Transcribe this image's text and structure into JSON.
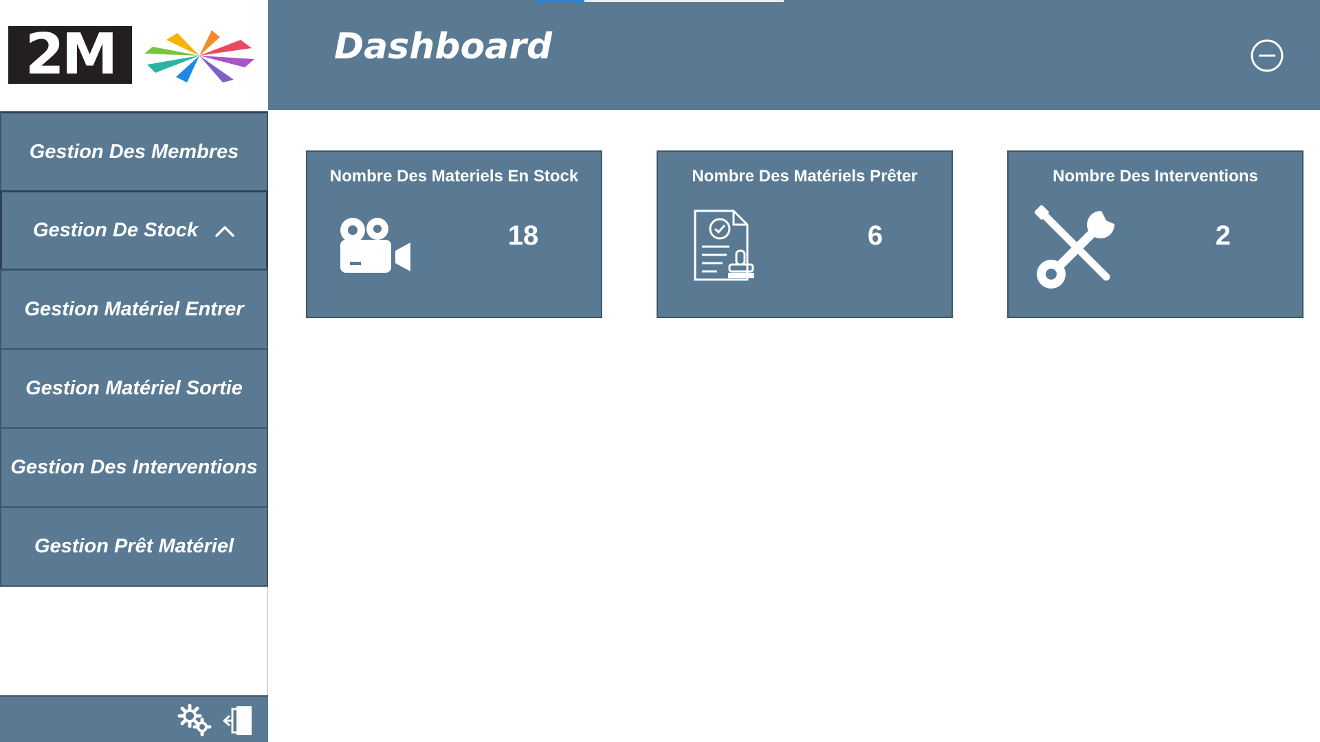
{
  "logo": {
    "text": "2M"
  },
  "header": {
    "title": "Dashboard"
  },
  "sidebar": {
    "items": [
      {
        "label": "Gestion Des Membres"
      },
      {
        "label": "Gestion De Stock"
      },
      {
        "label": "Gestion Matériel Entrer"
      },
      {
        "label": "Gestion Matériel Sortie"
      },
      {
        "label": "Gestion Des Interventions"
      },
      {
        "label": "Gestion Prêt Matériel"
      }
    ]
  },
  "cards": [
    {
      "title": "Nombre Des Materiels En Stock",
      "value": "18",
      "icon": "video-camera-icon"
    },
    {
      "title": "Nombre Des Matériels Prêter",
      "value": "6",
      "icon": "certificate-document-icon"
    },
    {
      "title": "Nombre Des Interventions",
      "value": "2",
      "icon": "tools-icon"
    }
  ],
  "footer_icons": [
    "settings-gears-icon",
    "logout-icon"
  ],
  "colors": {
    "panel": "#5a7a94",
    "panel_border": "#3f5568",
    "text": "#ffffff",
    "accent": "#1e88e5"
  }
}
